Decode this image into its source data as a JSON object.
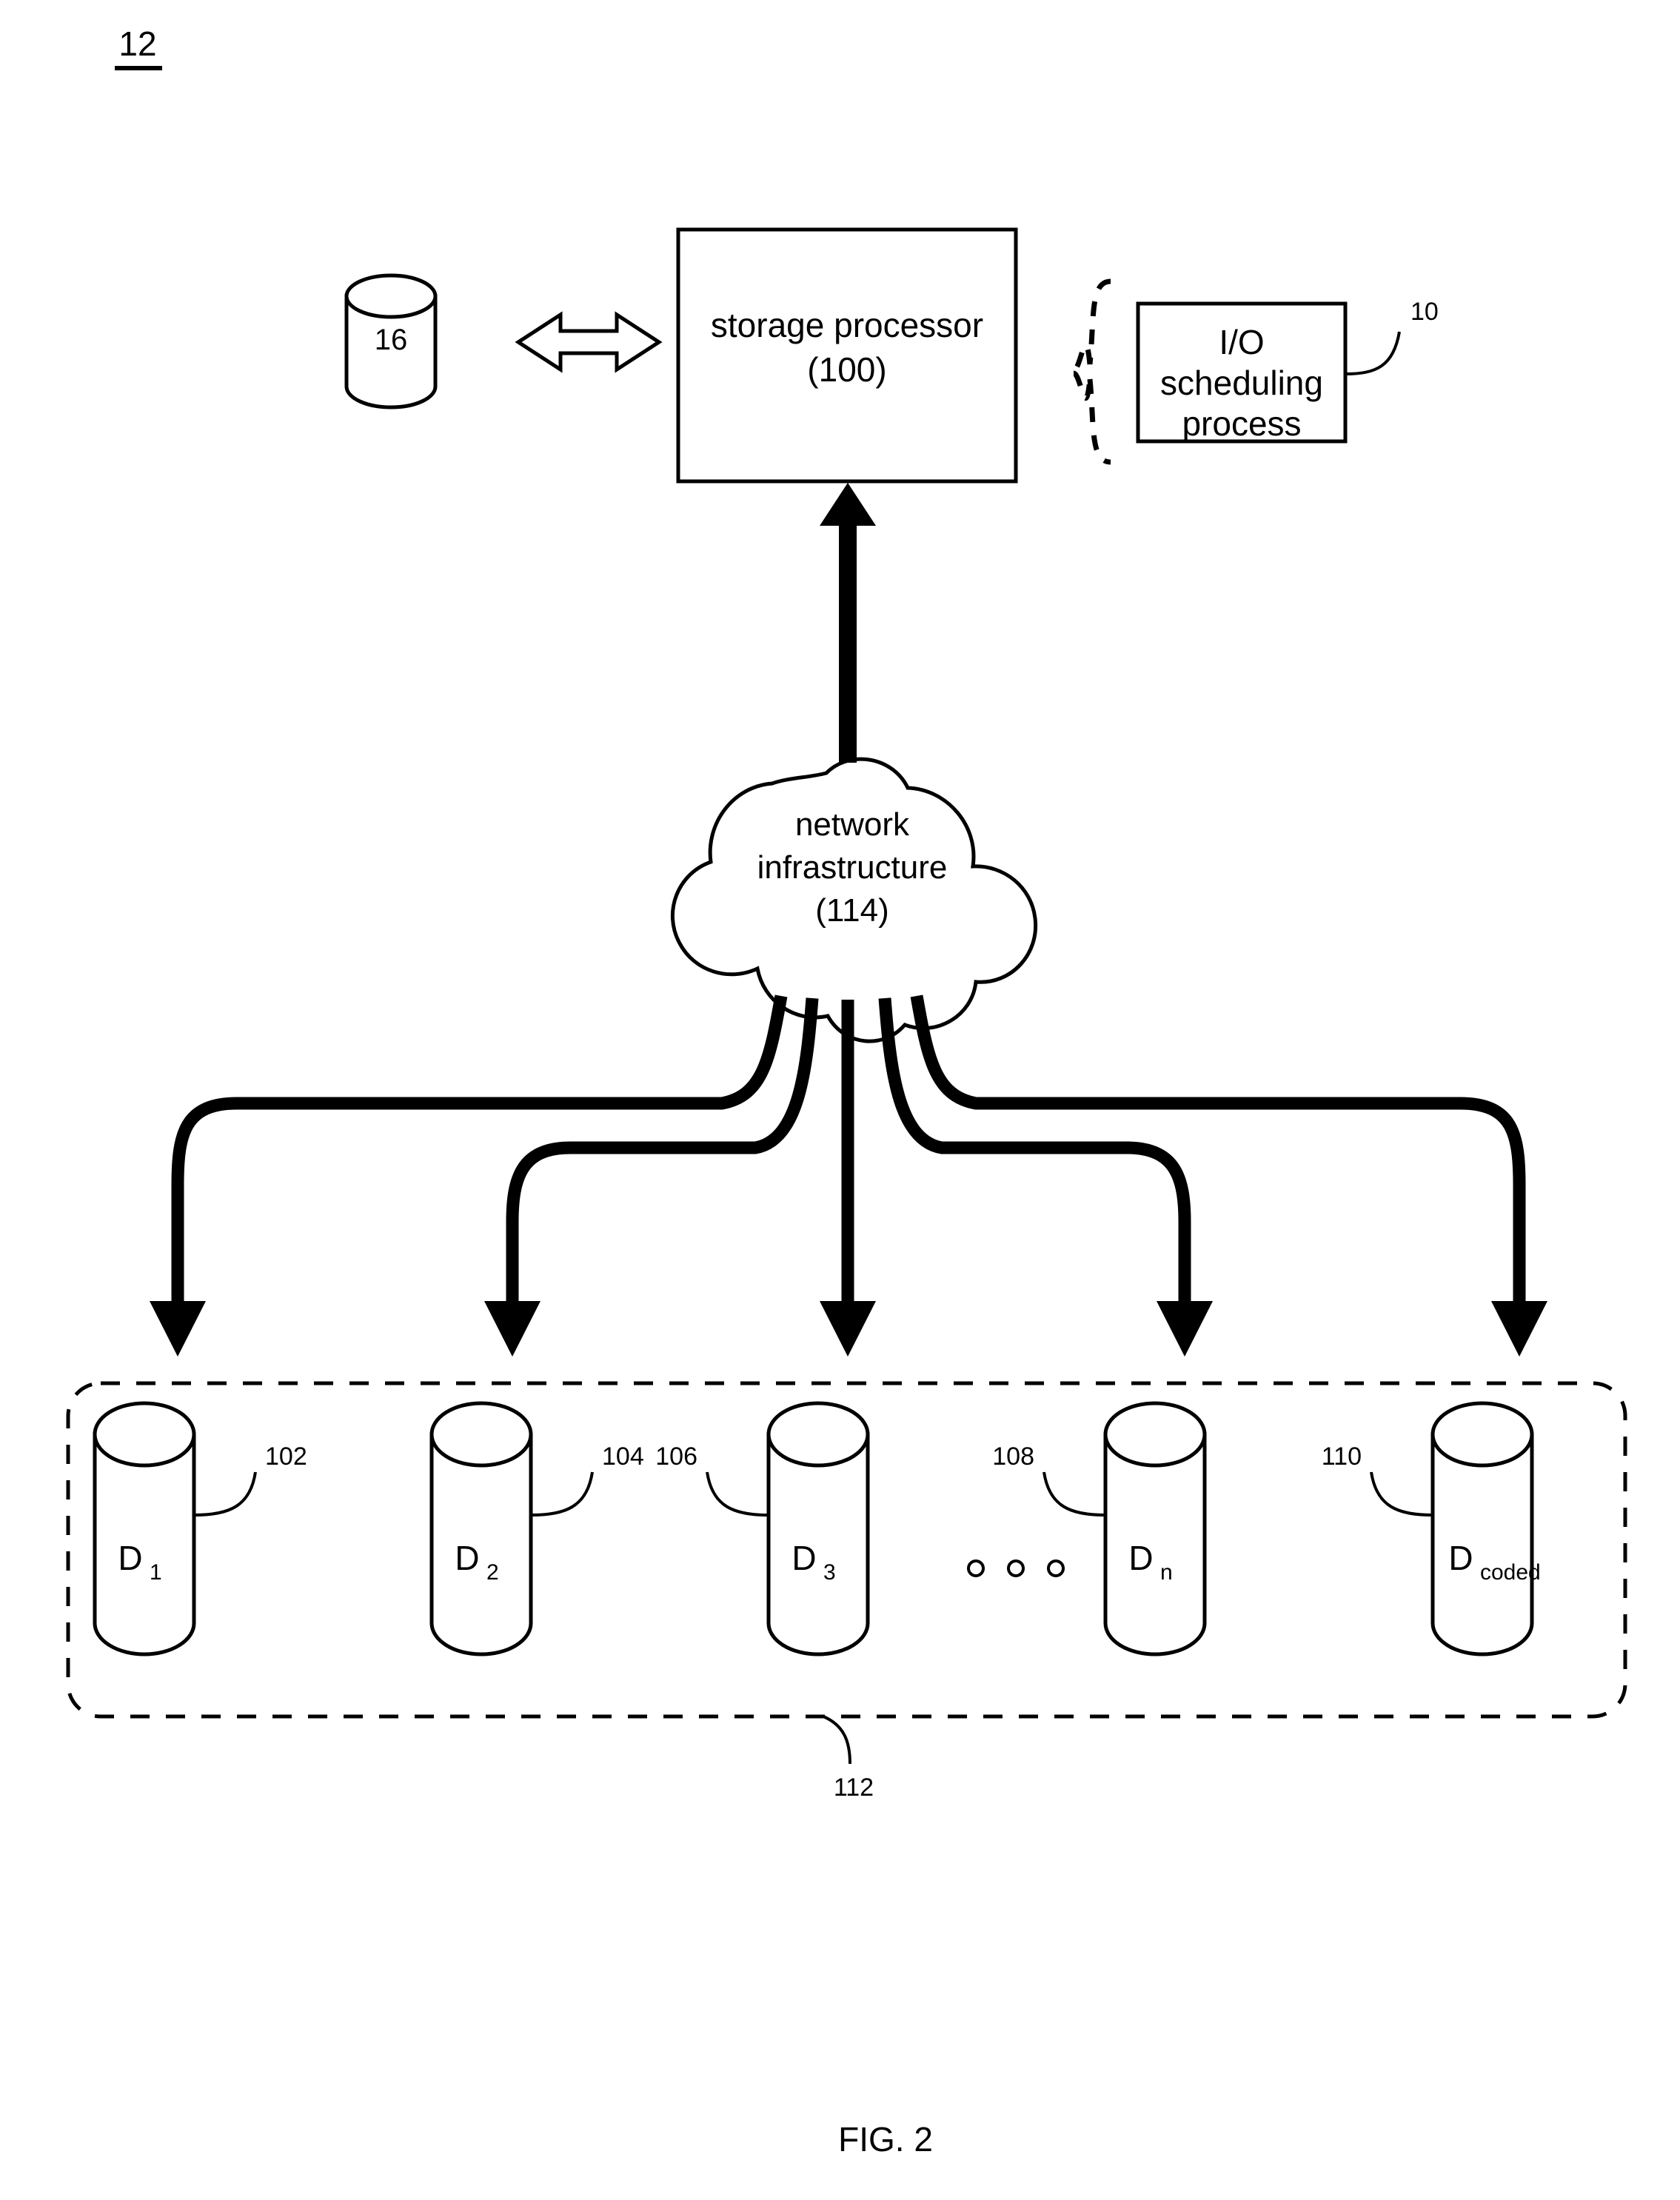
{
  "figure": {
    "sheet_label": "12",
    "caption": "FIG. 2"
  },
  "nodes": {
    "cache_cylinder": {
      "label": "16",
      "name": "cache-cylinder"
    },
    "storage_processor": {
      "line1": "storage processor",
      "line2": "(100)"
    },
    "io_scheduling_process": {
      "line1": "I/O",
      "line2": "scheduling",
      "line3": "process",
      "ref": "10"
    },
    "network_cloud": {
      "line1": "network",
      "line2": "infrastructure",
      "line3": "(114)"
    },
    "data_array": {
      "ref": "112",
      "ellipsis": "o  o  o"
    }
  },
  "disks": [
    {
      "base": "D",
      "sub": "1",
      "ref": "102",
      "ref_side": "right"
    },
    {
      "base": "D",
      "sub": "2",
      "ref": "104",
      "ref_side": "right"
    },
    {
      "base": "D",
      "sub": "3",
      "ref": "106",
      "ref_side": "left"
    },
    {
      "base": "D",
      "sub": "n",
      "ref": "108",
      "ref_side": "left"
    },
    {
      "base": "D",
      "sub": "coded",
      "ref": "110",
      "ref_side": "left"
    }
  ],
  "colors": {
    "ink": "#000000",
    "paper": "#ffffff"
  }
}
